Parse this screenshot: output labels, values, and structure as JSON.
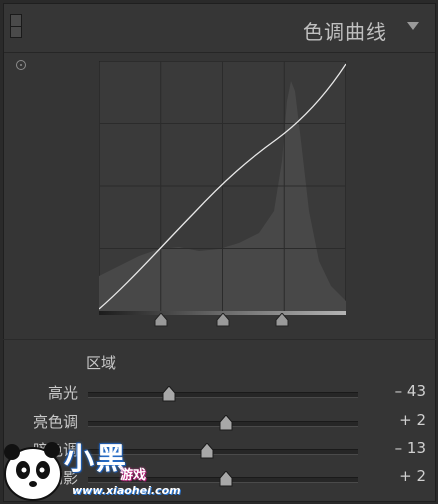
{
  "panel": {
    "title": "色调曲线",
    "collapse_icon": "triangle-down-icon",
    "target_icon": "target-adjust-icon"
  },
  "curve": {
    "handles": [
      0.25,
      0.5,
      0.74
    ]
  },
  "region": {
    "label": "区域",
    "sliders": [
      {
        "label": "高光",
        "value": "– 43",
        "position": 0.3
      },
      {
        "label": "亮色调",
        "value": "+ 2",
        "position": 0.51
      },
      {
        "label": "暗色调",
        "value": "– 13",
        "position": 0.44
      },
      {
        "label": "阴影",
        "value": "+ 2",
        "position": 0.51
      }
    ]
  },
  "watermark": {
    "brand": "小黑",
    "sub": "游戏",
    "url": "www.xiaohei.com"
  }
}
